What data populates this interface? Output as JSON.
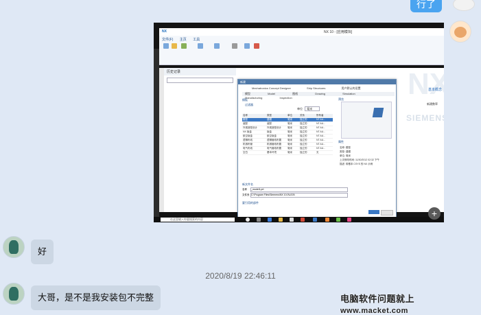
{
  "top_bubble": {
    "label": "行了"
  },
  "screenshot": {
    "app_title": "NX 10 - [应用模块]",
    "app_logo": "NX",
    "ribbon_tabs": [
      "文件(F)",
      "主页",
      "工具"
    ],
    "panel_header": "历史记录",
    "watermark_big": "NX",
    "watermark_small": "SIEMENS",
    "side_text_1": "基本概念",
    "side_text_2": "新建数率",
    "dialog": {
      "title": "新建",
      "tabs_top": [
        "Mechatronics Concept Designer",
        "Ship Structures",
        "用户默认的设置"
      ],
      "tabs_bottom": [
        "模型",
        "Model",
        "图纸",
        "Drawing",
        "Simulation",
        "Manufacturing",
        "Inspection"
      ],
      "section_template": "模板",
      "filter_label": "过滤器",
      "unit_label": "单位",
      "unit_value": "毫米",
      "columns": [
        "名称",
        "类型",
        "单位",
        "关系",
        "所有者"
      ],
      "rows": [
        [
          "模型",
          "建模",
          "毫米",
          "独立的",
          "NT AU..."
        ],
        [
          "装配",
          "装配",
          "毫米",
          "独立的",
          "NT AU..."
        ],
        [
          "外观造型设计",
          "外观造型设计",
          "毫米",
          "独立的",
          "NT AU..."
        ],
        [
          "NX 钣金",
          "钣金",
          "毫米",
          "独立的",
          "NT AU..."
        ],
        [
          "航空钣金",
          "航空钣金",
          "毫米",
          "独立的",
          "NT AU..."
        ],
        [
          "逻辑布线",
          "逻辑管线布置",
          "毫米",
          "独立的",
          "NT AU..."
        ],
        [
          "机械布管",
          "机械管线布置",
          "毫米",
          "独立的",
          "NT AU..."
        ],
        [
          "电气布线",
          "电气管线布置",
          "毫米",
          "独立的",
          "NT AU..."
        ],
        [
          "空白",
          "基本环境",
          "毫米",
          "独立的",
          "无"
        ]
      ],
      "preview_label": "预览",
      "properties_label": "属性",
      "properties": [
        "名称: 模型",
        "类型: 建模",
        "单位: 毫米",
        "上次修改时间: 11/30/2012 02:32 下午",
        "描述: 带基本 CSYS 的 NX 示例"
      ],
      "new_file_label": "新文件名",
      "name_label": "名称",
      "name_value": "_model1.prt",
      "folder_label": "文件夹",
      "folder_value": "C:\\Program Files\\Siemens\\NX 10.0\\UGII\\",
      "ref_label": "要引用的部件",
      "ok_label": "确定",
      "cancel_label": "取消"
    },
    "taskbar_search": "在这里输入你要搜索的内容"
  },
  "messages": [
    {
      "text": "好"
    },
    {
      "text": "大哥，是不是我安装包不完整"
    }
  ],
  "timestamp": "2020/8/19 22:46:11",
  "site_watermark": {
    "text": "电脑软件问题就上",
    "url": "www.macket.com"
  },
  "colors": {
    "bubble": "#ccd7e4",
    "background": "#dfe8f5",
    "sent_bubble": "#4aa4f0"
  }
}
